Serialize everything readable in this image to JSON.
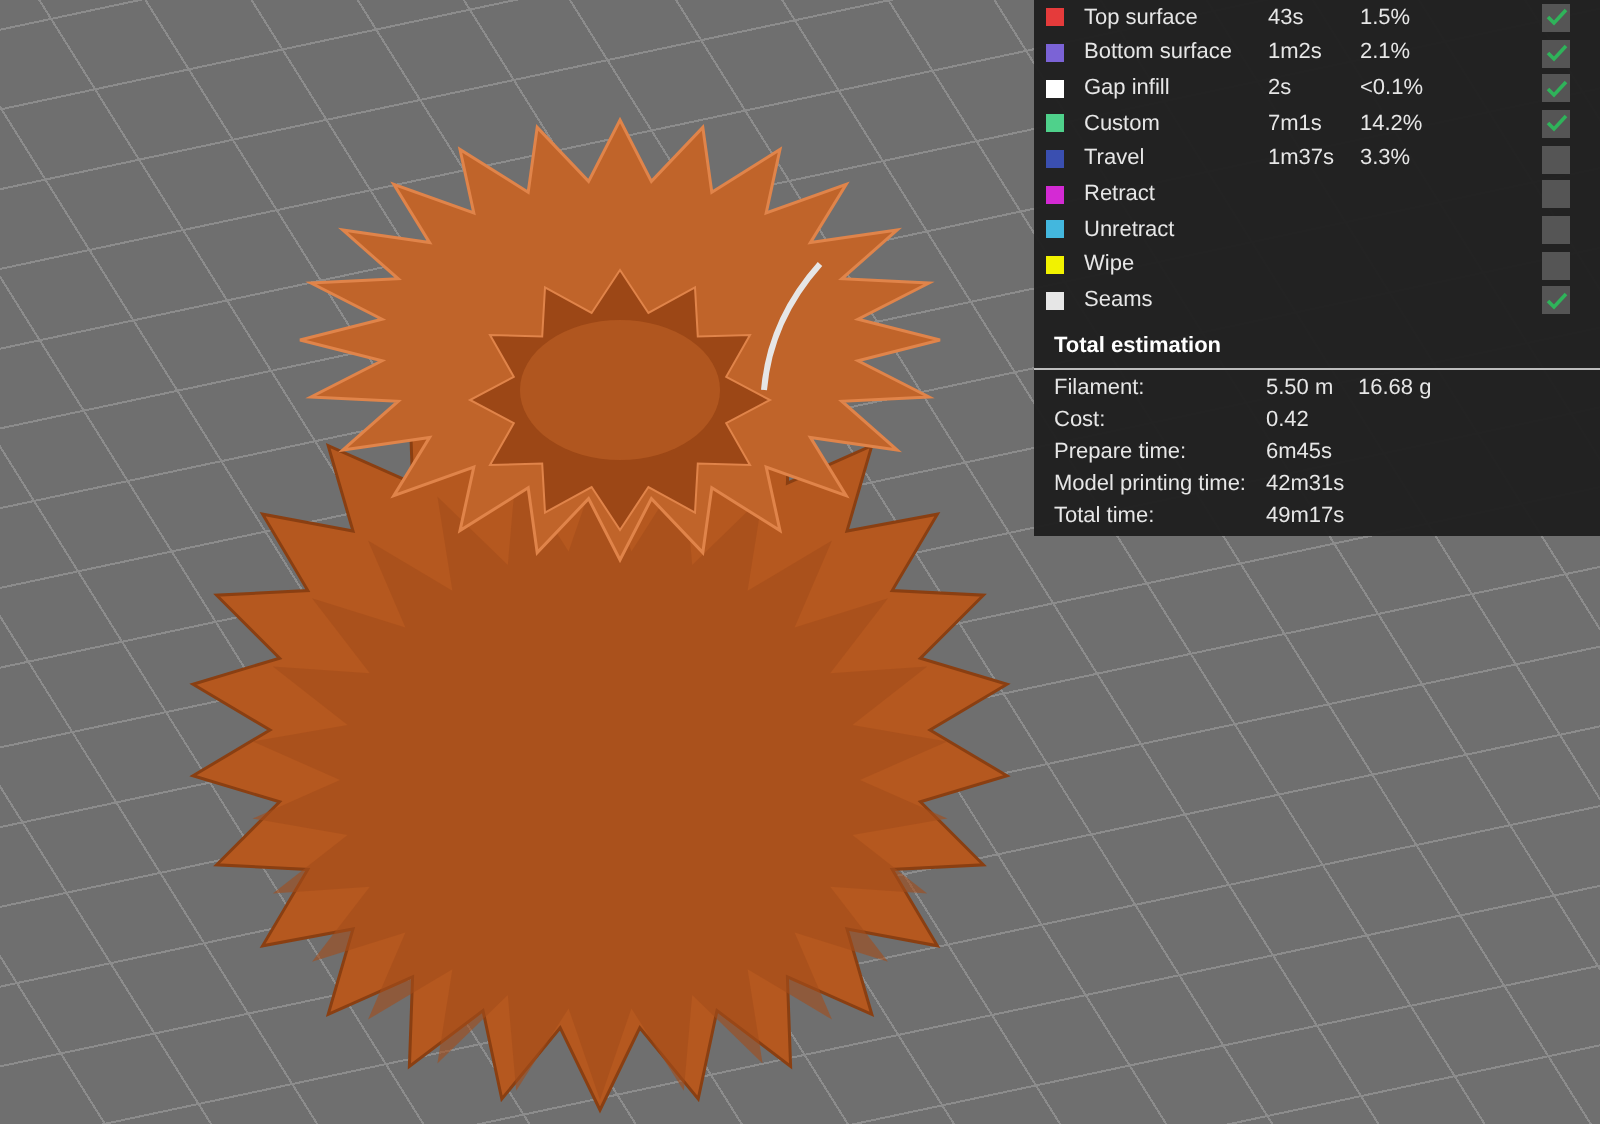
{
  "legend": [
    {
      "label": "Top surface",
      "time": "43s",
      "percent": "1.5%",
      "color": "#e53b3b",
      "checked": true
    },
    {
      "label": "Bottom surface",
      "time": "1m2s",
      "percent": "2.1%",
      "color": "#7b63d6",
      "checked": true
    },
    {
      "label": "Gap infill",
      "time": "2s",
      "percent": "<0.1%",
      "color": "#ffffff",
      "checked": true
    },
    {
      "label": "Custom",
      "time": "7m1s",
      "percent": "14.2%",
      "color": "#4fd18b",
      "checked": true
    },
    {
      "label": "Travel",
      "time": "1m37s",
      "percent": "3.3%",
      "color": "#3a4fb0",
      "checked": false
    },
    {
      "label": "Retract",
      "color": "#d42ad4",
      "checked": false
    },
    {
      "label": "Unretract",
      "color": "#43b7de",
      "checked": false
    },
    {
      "label": "Wipe",
      "color": "#f2f200",
      "checked": false
    },
    {
      "label": "Seams",
      "color": "#e6e6e6",
      "checked": true
    }
  ],
  "estimation": {
    "title": "Total estimation",
    "rows": [
      {
        "label": "Filament:",
        "values": [
          "5.50 m",
          "16.68 g"
        ]
      },
      {
        "label": "Cost:",
        "values": [
          "0.42"
        ]
      },
      {
        "label": "Prepare time:",
        "values": [
          "6m45s"
        ]
      },
      {
        "label": "Model printing time:",
        "values": [
          "42m31s"
        ]
      },
      {
        "label": "Total time:",
        "values": [
          "49m17s"
        ]
      }
    ]
  }
}
